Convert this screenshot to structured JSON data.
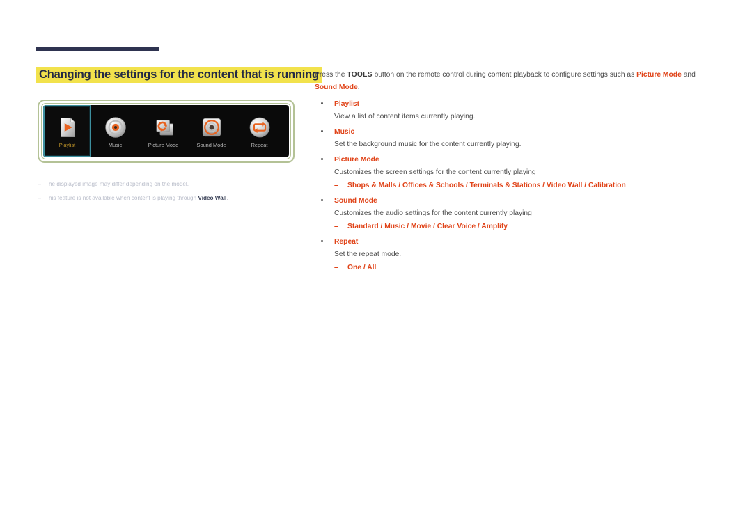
{
  "page": {
    "section_title": "Changing the settings for the content that is running"
  },
  "device_screen": {
    "tools": [
      {
        "label": "Playlist",
        "icon": "playlist-document-play-icon",
        "selected": true
      },
      {
        "label": "Music",
        "icon": "music-disc-icon",
        "selected": false
      },
      {
        "label": "Picture Mode",
        "icon": "picture-mode-refresh-icon",
        "selected": false
      },
      {
        "label": "Sound Mode",
        "icon": "sound-mode-speaker-icon",
        "selected": false
      },
      {
        "label": "Repeat",
        "icon": "repeat-loop-icon",
        "selected": false
      }
    ]
  },
  "notes": {
    "dash": "–",
    "items": [
      {
        "pre": "The displayed image may differ depending on the model.",
        "bold": "",
        "post": ""
      },
      {
        "pre": "This feature is not available when content is playing through ",
        "bold": "Video Wall",
        "post": "."
      }
    ]
  },
  "content": {
    "intro": {
      "part1": "Press the ",
      "tools_key": "TOOLS",
      "part2": " button on the remote control during content playback to configure settings such as ",
      "picture_mode": "Picture Mode",
      "part3": " and ",
      "sound_mode": "Sound Mode",
      "part4": "."
    },
    "bullet_dash": "–",
    "items": [
      {
        "title": "Playlist",
        "desc": "View a list of content items currently playing.",
        "options": ""
      },
      {
        "title": "Music",
        "desc": "Set the background music for the content currently playing.",
        "options": ""
      },
      {
        "title": "Picture Mode",
        "desc": "Customizes the screen settings for the content currently playing",
        "options": "Shops & Malls / Offices & Schools / Terminals & Stations / Video Wall / Calibration"
      },
      {
        "title": "Sound Mode",
        "desc": "Customizes the audio settings for the content currently playing",
        "options": "Standard / Music / Movie / Clear Voice / Amplify"
      },
      {
        "title": "Repeat",
        "desc": "Set the repeat mode.",
        "options": "One / All"
      }
    ]
  },
  "colors": {
    "accent_red": "#e04318",
    "highlight_yellow": "#f2e24c",
    "title_navy": "#232a44",
    "rule_navy": "#2e3350",
    "panel_border_green": "#b4c296",
    "selection_teal": "#3d8f9e",
    "label_gold": "#c79a2a",
    "icon_orange": "#e8621f"
  }
}
